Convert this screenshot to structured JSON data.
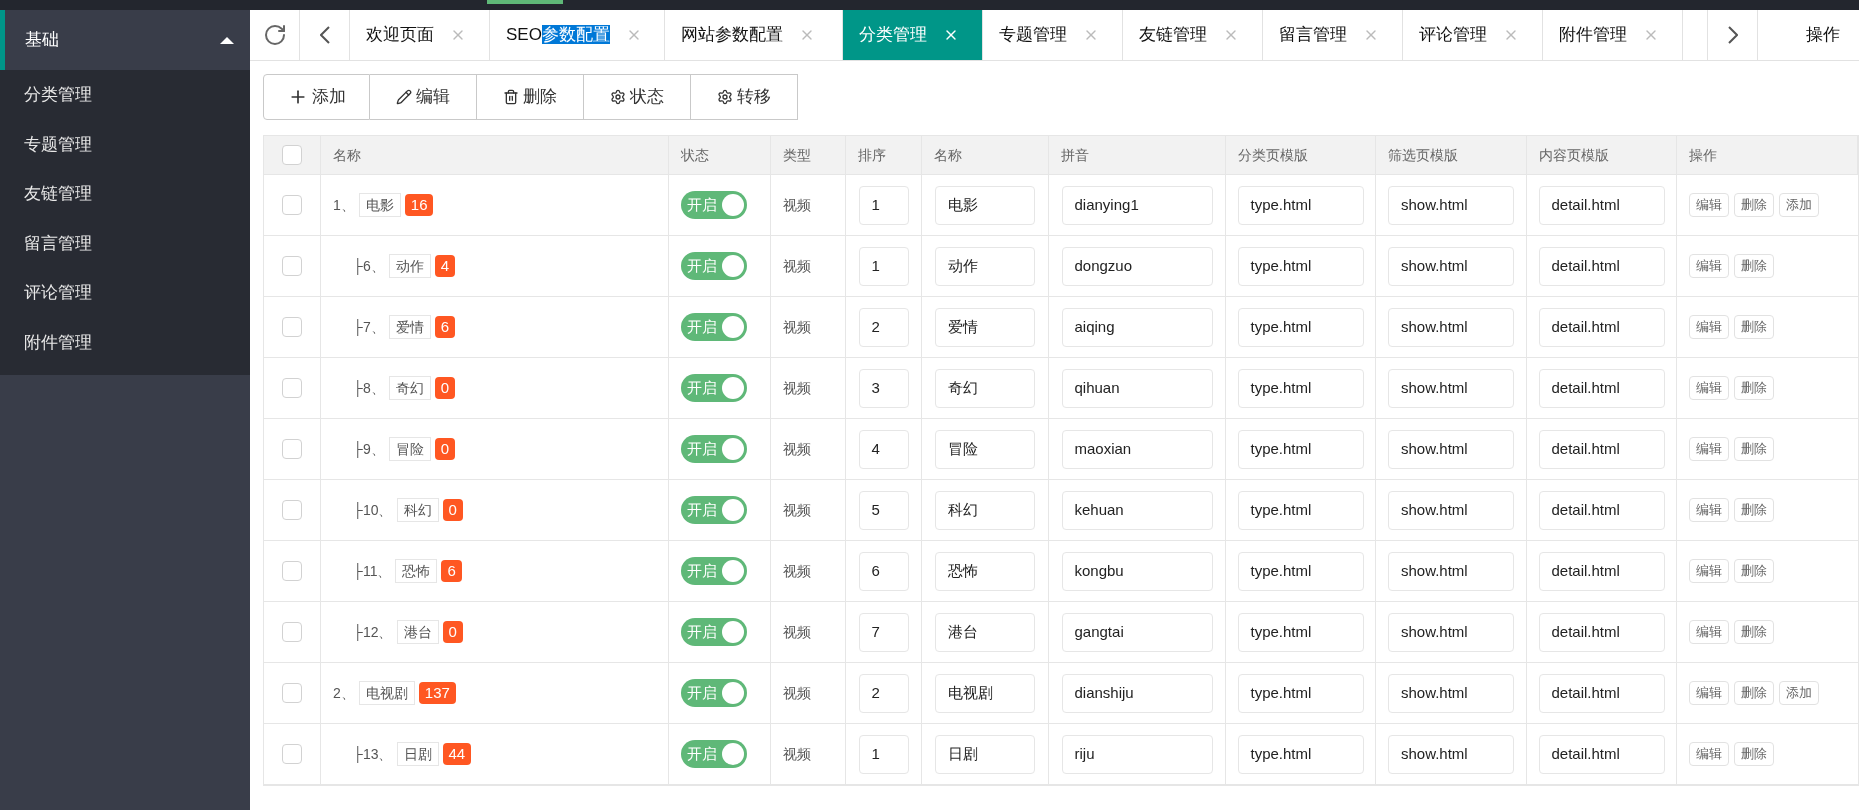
{
  "sidebar": {
    "group": {
      "label": "基础",
      "expanded": true
    },
    "items": [
      {
        "label": "分类管理",
        "selected": false
      },
      {
        "label": "专题管理",
        "selected": false
      },
      {
        "label": "友链管理",
        "selected": false
      },
      {
        "label": "留言管理",
        "selected": false
      },
      {
        "label": "评论管理",
        "selected": false
      },
      {
        "label": "附件管理",
        "selected": false
      }
    ]
  },
  "tabs": [
    {
      "label": "欢迎页面",
      "selected": false
    },
    {
      "label": "SEO",
      "selected_text": "参数配置",
      "selected": false
    },
    {
      "label": "网站参数配置",
      "selected": false
    },
    {
      "label": "分类管理",
      "selected": true
    },
    {
      "label": "专题管理",
      "selected": false
    },
    {
      "label": "友链管理",
      "selected": false
    },
    {
      "label": "留言管理",
      "selected": false
    },
    {
      "label": "评论管理",
      "selected": false
    },
    {
      "label": "附件管理",
      "selected": false
    }
  ],
  "tab_menu": "操作",
  "toolbar": [
    {
      "kind": "plus",
      "label": "添加"
    },
    {
      "kind": "pencil",
      "label": "编辑"
    },
    {
      "kind": "trash",
      "label": "删除"
    },
    {
      "kind": "gear",
      "label": "状态"
    },
    {
      "kind": "gear",
      "label": "转移"
    }
  ],
  "table": {
    "all_checked": false,
    "columns": [
      "名称",
      "状态",
      "类型",
      "排序",
      "名称",
      "拼音",
      "分类页模版",
      "筛选页模版",
      "内容页模版",
      "操作"
    ],
    "rows": [
      {
        "prefix": "1、",
        "tag": "电影",
        "count": "16",
        "checked": false,
        "status": {
          "on": true,
          "label": "开启"
        },
        "type": "视频",
        "sort": "1",
        "name": "电影",
        "pinyin": "dianying1",
        "type_tpl": "type.html",
        "show_tpl": "show.html",
        "detail_tpl": "detail.html",
        "actions": [
          "编辑",
          "删除",
          "添加"
        ],
        "children": [
          {
            "prefix": "├6、",
            "tag": "动作",
            "count": "4",
            "checked": false,
            "status": {
              "on": true,
              "label": "开启"
            },
            "type": "视频",
            "sort": "1",
            "name": "动作",
            "pinyin": "dongzuo",
            "type_tpl": "type.html",
            "show_tpl": "show.html",
            "detail_tpl": "detail.html",
            "actions": [
              "编辑",
              "删除"
            ]
          },
          {
            "prefix": "├7、",
            "tag": "爱情",
            "count": "6",
            "checked": false,
            "status": {
              "on": true,
              "label": "开启"
            },
            "type": "视频",
            "sort": "2",
            "name": "爱情",
            "pinyin": "aiqing",
            "type_tpl": "type.html",
            "show_tpl": "show.html",
            "detail_tpl": "detail.html",
            "actions": [
              "编辑",
              "删除"
            ]
          },
          {
            "prefix": "├8、",
            "tag": "奇幻",
            "count": "0",
            "checked": false,
            "status": {
              "on": true,
              "label": "开启"
            },
            "type": "视频",
            "sort": "3",
            "name": "奇幻",
            "pinyin": "qihuan",
            "type_tpl": "type.html",
            "show_tpl": "show.html",
            "detail_tpl": "detail.html",
            "actions": [
              "编辑",
              "删除"
            ]
          },
          {
            "prefix": "├9、",
            "tag": "冒险",
            "count": "0",
            "checked": false,
            "status": {
              "on": true,
              "label": "开启"
            },
            "type": "视频",
            "sort": "4",
            "name": "冒险",
            "pinyin": "maoxian",
            "type_tpl": "type.html",
            "show_tpl": "show.html",
            "detail_tpl": "detail.html",
            "actions": [
              "编辑",
              "删除"
            ]
          },
          {
            "prefix": "├10、",
            "tag": "科幻",
            "count": "0",
            "checked": false,
            "status": {
              "on": true,
              "label": "开启"
            },
            "type": "视频",
            "sort": "5",
            "name": "科幻",
            "pinyin": "kehuan",
            "type_tpl": "type.html",
            "show_tpl": "show.html",
            "detail_tpl": "detail.html",
            "actions": [
              "编辑",
              "删除"
            ]
          },
          {
            "prefix": "├11、",
            "tag": "恐怖",
            "count": "6",
            "checked": false,
            "status": {
              "on": true,
              "label": "开启"
            },
            "type": "视频",
            "sort": "6",
            "name": "恐怖",
            "pinyin": "kongbu",
            "type_tpl": "type.html",
            "show_tpl": "show.html",
            "detail_tpl": "detail.html",
            "actions": [
              "编辑",
              "删除"
            ]
          },
          {
            "prefix": "├12、",
            "tag": "港台",
            "count": "0",
            "checked": false,
            "status": {
              "on": true,
              "label": "开启"
            },
            "type": "视频",
            "sort": "7",
            "name": "港台",
            "pinyin": "gangtai",
            "type_tpl": "type.html",
            "show_tpl": "show.html",
            "detail_tpl": "detail.html",
            "actions": [
              "编辑",
              "删除"
            ]
          }
        ]
      },
      {
        "prefix": "2、",
        "tag": "电视剧",
        "count": "137",
        "checked": false,
        "status": {
          "on": true,
          "label": "开启"
        },
        "type": "视频",
        "sort": "2",
        "name": "电视剧",
        "pinyin": "dianshiju",
        "type_tpl": "type.html",
        "show_tpl": "show.html",
        "detail_tpl": "detail.html",
        "actions": [
          "编辑",
          "删除",
          "添加"
        ],
        "children": [
          {
            "prefix": "├13、",
            "tag": "日剧",
            "count": "44",
            "checked": false,
            "status": {
              "on": true,
              "label": "开启"
            },
            "type": "视频",
            "sort": "1",
            "name": "日剧",
            "pinyin": "riju",
            "type_tpl": "type.html",
            "show_tpl": "show.html",
            "detail_tpl": "detail.html",
            "actions": [
              "编辑",
              "删除"
            ]
          }
        ]
      }
    ]
  }
}
